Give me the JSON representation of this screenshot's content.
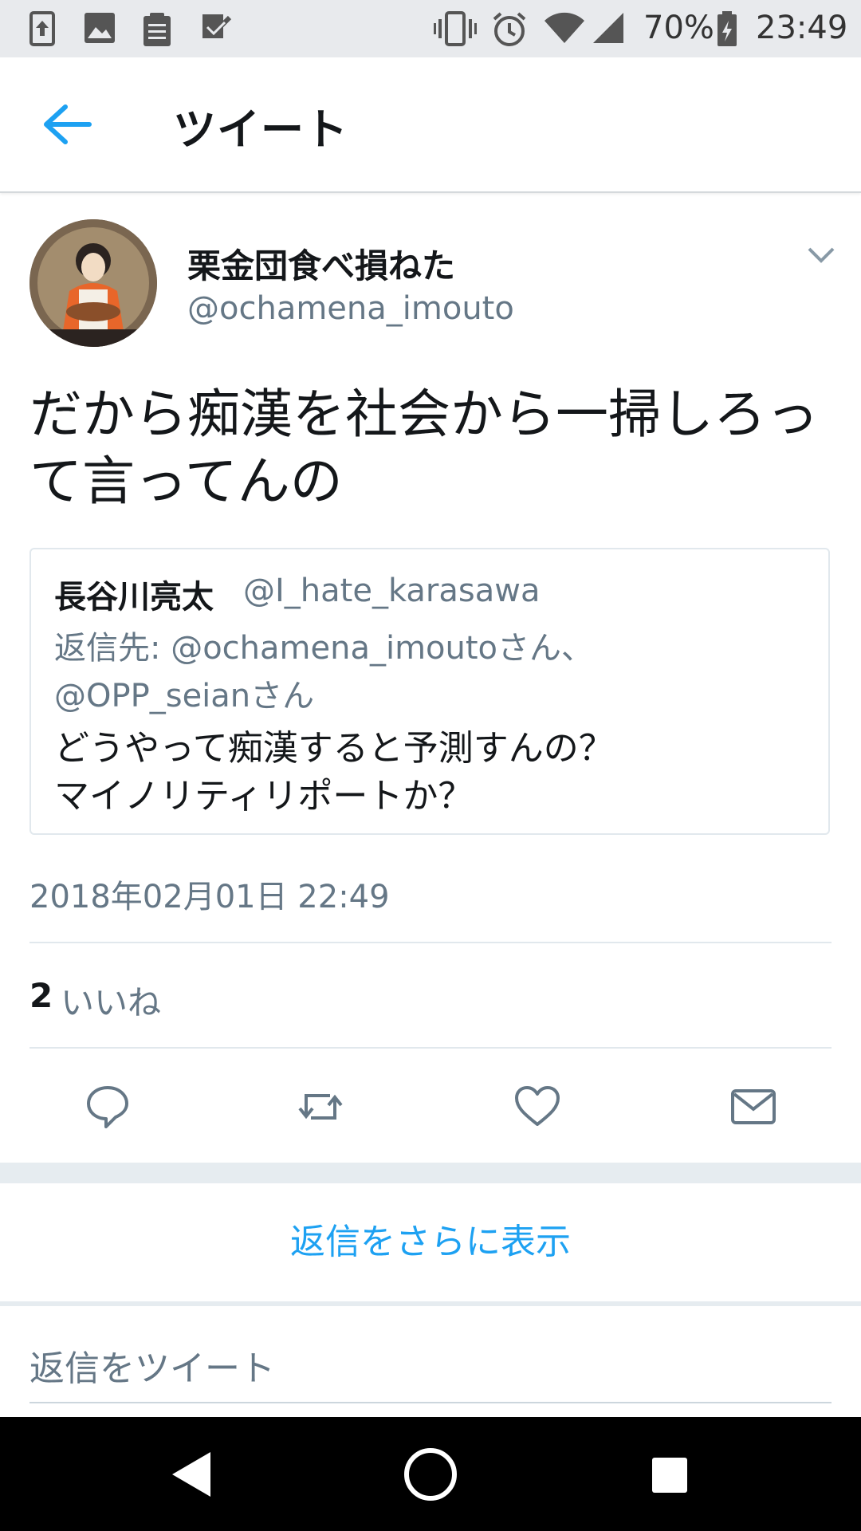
{
  "status_bar": {
    "battery": "70%",
    "time": "23:49"
  },
  "header": {
    "title": "ツイート"
  },
  "tweet": {
    "display_name": "栗金団食べ損ねた",
    "handle": "@ochamena_imouto",
    "text_line1": "だから痴漢を社会から一掃しろっ",
    "text_line2": "て言ってんの",
    "timestamp": "2018年02月01日 22:49",
    "likes_count": "2",
    "likes_label": "いいね"
  },
  "quote": {
    "name": "長谷川亮太",
    "handle": "@I_hate_karasawa",
    "reply_line1": "返信先: @ochamena_imoutoさん、",
    "reply_line2": "@OPP_seianさん",
    "text_line1": "どうやって痴漢すると予測すんの？",
    "text_line2": "マイノリティリポートか？"
  },
  "more_replies": "返信をさらに表示",
  "reply_input": {
    "placeholder": "返信をツイート"
  },
  "colors": {
    "accent": "#1da1f2",
    "secondary_text": "#657786",
    "primary_text": "#14171a"
  },
  "icons": {
    "status_left": [
      "upload-icon",
      "image-icon",
      "clipboard-icon",
      "checkmark-icon"
    ],
    "status_right": [
      "vibrate-icon",
      "alarm-icon",
      "wifi-icon",
      "signal-icon",
      "battery-icon"
    ],
    "actions": [
      "reply-icon",
      "retweet-icon",
      "like-icon",
      "share-mail-icon"
    ],
    "navbar": [
      "nav-back-icon",
      "nav-home-icon",
      "nav-recents-icon"
    ]
  }
}
